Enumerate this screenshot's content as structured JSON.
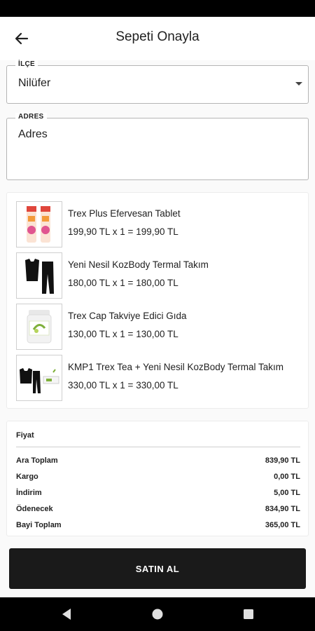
{
  "header": {
    "title": "Sepeti Onayla",
    "back_icon": "arrow-left-icon"
  },
  "district": {
    "label": "İLÇE",
    "value": "Nilüfer"
  },
  "address": {
    "label": "ADRES",
    "value": "Adres"
  },
  "items": [
    {
      "name": "Trex Plus Efervesan Tablet",
      "price": "199,90 TL x 1 = 199,90 TL",
      "image": "effervescent-tablet-tubes"
    },
    {
      "name": "Yeni Nesil KozBody Termal Takım",
      "price": "180,00 TL x 1 = 180,00 TL",
      "image": "thermal-set"
    },
    {
      "name": "Trex  Cap Takviye Edici Gıda",
      "price": "130,00 TL x 1 = 130,00 TL",
      "image": "supplement-jar"
    },
    {
      "name": "KMP1 Trex Tea + Yeni Nesil KozBody Termal Takım",
      "price": "330,00 TL x 1 = 330,00 TL",
      "image": "bundle"
    }
  ],
  "summary": {
    "title": "Fiyat",
    "rows": [
      {
        "label": "Ara Toplam",
        "value": "839,90 TL"
      },
      {
        "label": "Kargo",
        "value": "0,00 TL"
      },
      {
        "label": "İndirim",
        "value": "5,00 TL"
      },
      {
        "label": "Ödenecek",
        "value": "834,90 TL"
      },
      {
        "label": "Bayi Toplam",
        "value": "365,00 TL"
      }
    ]
  },
  "actions": {
    "buy_label": "SATIN AL"
  },
  "colors": {
    "button": "#1a1a1a",
    "background": "#fafafa",
    "border": "#b5b5b5"
  },
  "nav": {
    "back_icon": "triangle-back-icon",
    "home_icon": "circle-home-icon",
    "recents_icon": "square-recents-icon"
  }
}
